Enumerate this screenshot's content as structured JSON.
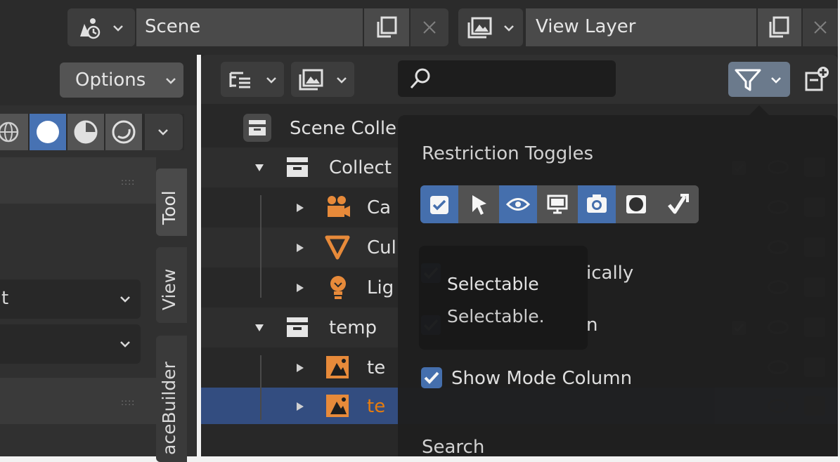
{
  "topbar": {
    "scene_label": "Scene",
    "view_layer_label": "View Layer"
  },
  "properties": {
    "options_label": "Options",
    "tabs": [
      {
        "label": "Tool"
      },
      {
        "label": "View"
      },
      {
        "label": "aceBuilder"
      }
    ]
  },
  "outliner": {
    "search": {
      "value": "",
      "placeholder": ""
    },
    "tree": {
      "scene_collection": "Scene Colle",
      "collection": "Collect",
      "camera": "Ca",
      "cube": "Cul",
      "light": "Lig",
      "temp": "temp",
      "temp_a": "te",
      "temp_b": "te"
    }
  },
  "filter_popover": {
    "restriction_title": "Restriction Toggles",
    "toggles": [
      {
        "icon": "checkbox-icon",
        "active": true
      },
      {
        "icon": "cursor-arrow-icon",
        "active": false
      },
      {
        "icon": "eye-icon",
        "active": true
      },
      {
        "icon": "monitor-icon",
        "active": false
      },
      {
        "icon": "camera-icon",
        "active": true
      },
      {
        "icon": "holdout-icon",
        "active": false
      },
      {
        "icon": "indirect-only-icon",
        "active": false
      }
    ],
    "sort_tail": "ically",
    "sync_tail": "n",
    "show_mode_column": "Show Mode Column",
    "search_heading": "Search"
  },
  "tooltip": {
    "title": "Selectable",
    "description": "Selectable."
  },
  "colors": {
    "active_toggle": "#4772b3",
    "selected_row": "#334d80",
    "selected_text": "#e87d0d",
    "object_orange": "#e78a3a"
  }
}
